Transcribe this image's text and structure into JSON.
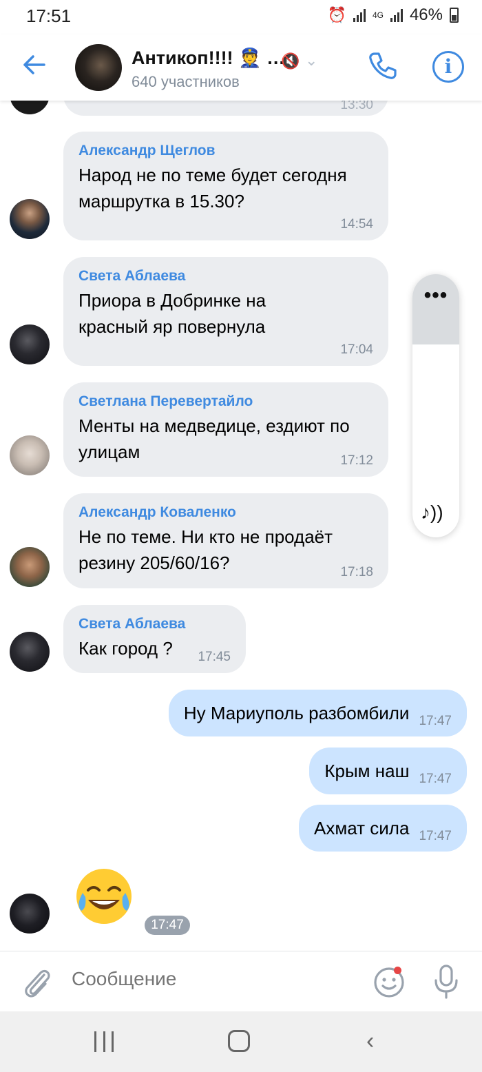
{
  "status_bar": {
    "time": "17:51",
    "network": "4G",
    "battery": "46%"
  },
  "header": {
    "title": "Антикоп!!!! 👮 …",
    "subtitle": "640 участников"
  },
  "partial_message": {
    "time": "13:30"
  },
  "messages_in": [
    {
      "name": "Александр Щеглов",
      "text": "Народ не по теме будет сегодня маршрутка в 15.30?",
      "time": "14:54"
    },
    {
      "name": "Света Аблаева",
      "text": "Приора в Добринке на красный яр повернула",
      "time": "17:04"
    },
    {
      "name": "Светлана Перевертайло",
      "text": "Менты на медведице, ездиют по улицам",
      "time": "17:12"
    },
    {
      "name": "Александр Коваленко",
      "text": "Не по теме. Ни кто не продаёт резину 205/60/16?",
      "time": "17:18"
    },
    {
      "name": "Света Аблаева",
      "text": "Как город ?",
      "time": "17:45"
    }
  ],
  "messages_out": [
    {
      "text": "Ну Мариуполь разбомбили",
      "time": "17:47"
    },
    {
      "text": "Крым наш",
      "time": "17:47"
    },
    {
      "text": "Ахмат сила",
      "time": "17:47"
    }
  ],
  "sticker": {
    "emoji": "😂",
    "time": "17:47"
  },
  "audio_widget": {
    "dots": "•••",
    "note": "♪))"
  },
  "composer": {
    "placeholder": "Сообщение"
  },
  "colors": {
    "accent": "#3f8ae0",
    "bubble_in": "#ebedf0",
    "bubble_out": "#cce4ff"
  }
}
